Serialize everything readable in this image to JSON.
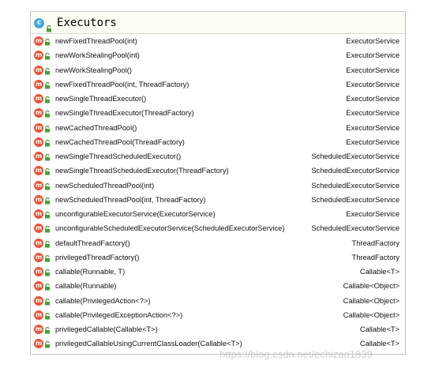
{
  "class": {
    "icon_letter": "c",
    "name": "Executors"
  },
  "icon_color": "#4aa8d8",
  "method_icon_color": "#e8553a",
  "lock_color": "#4c9b3c",
  "method_icon_letter": "m",
  "methods": [
    {
      "signature": "newFixedThreadPool(int)",
      "returns": "ExecutorService"
    },
    {
      "signature": "newWorkStealingPool(int)",
      "returns": "ExecutorService"
    },
    {
      "signature": "newWorkStealingPool()",
      "returns": "ExecutorService"
    },
    {
      "signature": "newFixedThreadPool(int, ThreadFactory)",
      "returns": "ExecutorService"
    },
    {
      "signature": "newSingleThreadExecutor()",
      "returns": "ExecutorService"
    },
    {
      "signature": "newSingleThreadExecutor(ThreadFactory)",
      "returns": "ExecutorService"
    },
    {
      "signature": "newCachedThreadPool()",
      "returns": "ExecutorService"
    },
    {
      "signature": "newCachedThreadPool(ThreadFactory)",
      "returns": "ExecutorService"
    },
    {
      "signature": "newSingleThreadScheduledExecutor()",
      "returns": "ScheduledExecutorService"
    },
    {
      "signature": "newSingleThreadScheduledExecutor(ThreadFactory)",
      "returns": "ScheduledExecutorService"
    },
    {
      "signature": "newScheduledThreadPool(int)",
      "returns": "ScheduledExecutorService"
    },
    {
      "signature": "newScheduledThreadPool(int, ThreadFactory)",
      "returns": "ScheduledExecutorService"
    },
    {
      "signature": "unconfigurableExecutorService(ExecutorService)",
      "returns": "ExecutorService"
    },
    {
      "signature": "unconfigurableScheduledExecutorService(ScheduledExecutorService)",
      "returns": "ScheduledExecutorService"
    },
    {
      "signature": "defaultThreadFactory()",
      "returns": "ThreadFactory"
    },
    {
      "signature": "privilegedThreadFactory()",
      "returns": "ThreadFactory"
    },
    {
      "signature": "callable(Runnable, T)",
      "returns": "Callable<T>"
    },
    {
      "signature": "callable(Runnable)",
      "returns": "Callable<Object>"
    },
    {
      "signature": "callable(PrivilegedAction<?>)",
      "returns": "Callable<Object>"
    },
    {
      "signature": "callable(PrivilegedExceptionAction<?>)",
      "returns": "Callable<Object>"
    },
    {
      "signature": "privilegedCallable(Callable<T>)",
      "returns": "Callable<T>"
    },
    {
      "signature": "privilegedCallableUsingCurrentClassLoader(Callable<T>)",
      "returns": "Callable<T>"
    }
  ],
  "watermark": "https://blog.csdn.net/echizao1839"
}
